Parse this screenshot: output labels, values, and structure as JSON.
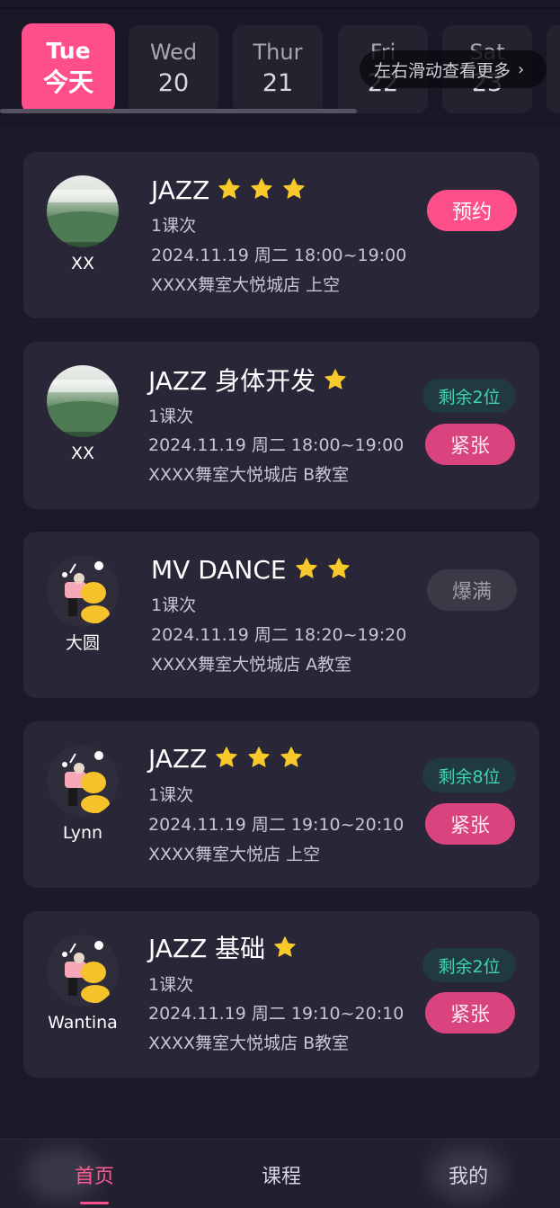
{
  "days": [
    {
      "weekday": "Tue",
      "date": "今天",
      "active": true
    },
    {
      "weekday": "Wed",
      "date": "20",
      "active": false
    },
    {
      "weekday": "Thur",
      "date": "21",
      "active": false
    },
    {
      "weekday": "Fri",
      "date": "22",
      "active": false
    },
    {
      "weekday": "Sat",
      "date": "23",
      "active": false
    }
  ],
  "scroll_hint": "左右滑动查看更多",
  "courses": [
    {
      "teacher": "XX",
      "avatar": "landscape-photo",
      "title": "JAZZ",
      "stars": 3,
      "sessions": "1课次",
      "time": "2024.11.19 周二 18:00~19:00",
      "location": "XXXX舞室大悦城店 上空",
      "remaining": "",
      "action": "预约"
    },
    {
      "teacher": "XX",
      "avatar": "landscape-photo",
      "title": "JAZZ 身体开发",
      "stars": 1,
      "sessions": "1课次",
      "time": "2024.11.19 周二 18:00~19:00",
      "location": "XXXX舞室大悦城店 B教室",
      "remaining": "剩余2位",
      "action": "紧张"
    },
    {
      "teacher": "大圆",
      "avatar": "dancer-illustration",
      "title": "MV DANCE",
      "stars": 2,
      "sessions": "1课次",
      "time": "2024.11.19 周二 18:20~19:20",
      "location": "XXXX舞室大悦城店 A教室",
      "remaining": "",
      "action": "爆满"
    },
    {
      "teacher": "Lynn",
      "avatar": "dancer-illustration",
      "title": "JAZZ",
      "stars": 3,
      "sessions": "1课次",
      "time": "2024.11.19 周二 19:10~20:10",
      "location": "XXXX舞室大悦店 上空",
      "remaining": "剩余8位",
      "action": "紧张"
    },
    {
      "teacher": "Wantina",
      "avatar": "dancer-illustration",
      "title": "JAZZ 基础",
      "stars": 1,
      "sessions": "1课次",
      "time": "2024.11.19 周二 19:10~20:10",
      "location": "XXXX舞室大悦城店 B教室",
      "remaining": "剩余2位",
      "action": "紧张"
    }
  ],
  "nav": {
    "home": "首页",
    "courses": "课程",
    "mine": "我的"
  },
  "colors": {
    "accent": "#ff4f8b",
    "background": "#1c1a29",
    "card": "#282637",
    "star": "#f8c92a",
    "remain_text": "#3fd3b5"
  }
}
